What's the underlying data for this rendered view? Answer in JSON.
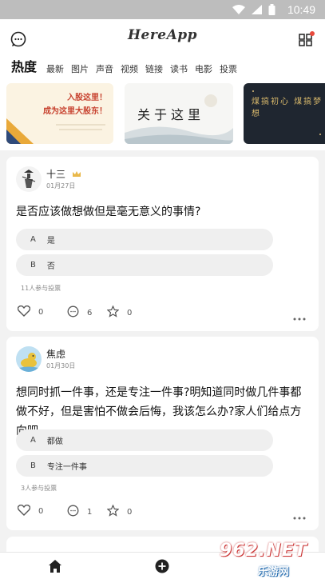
{
  "status": {
    "time": "10:49"
  },
  "app": {
    "title": "HereApp"
  },
  "tabs": [
    "热度",
    "最新",
    "图片",
    "声音",
    "视频",
    "链接",
    "读书",
    "电影",
    "投票"
  ],
  "banners": [
    {
      "line1": "入股这里！",
      "line2": "成为这里大股东！"
    },
    {
      "text": "关于这里"
    },
    {
      "text": "煤搞初心 煤搞梦想"
    }
  ],
  "posts": [
    {
      "user": "十三",
      "date": "01月27日",
      "question": "是否应该做想做但是毫无意义的事情?",
      "options": [
        {
          "letter": "A",
          "text": "是"
        },
        {
          "letter": "B",
          "text": "否"
        }
      ],
      "participants": "11人参与投票",
      "likes": "0",
      "comments": "6",
      "favorites": "0"
    },
    {
      "user": "焦虑",
      "date": "01月30日",
      "question": "想同时抓一件事，还是专注一件事?明知道同时做几件事都做不好，但是害怕不做会后悔，我该怎么办?家人们给点方向吧",
      "options": [
        {
          "letter": "A",
          "text": "都做"
        },
        {
          "letter": "B",
          "text": "专注一件事"
        }
      ],
      "participants": "3人参与投票",
      "likes": "0",
      "comments": "1",
      "favorites": "0"
    }
  ],
  "watermark": {
    "brand": "962.NET",
    "sub": "乐游网"
  },
  "colors": {
    "accent": "#e8493c",
    "crown": "#e9b84a",
    "statusbar": "#bdbdbd"
  }
}
